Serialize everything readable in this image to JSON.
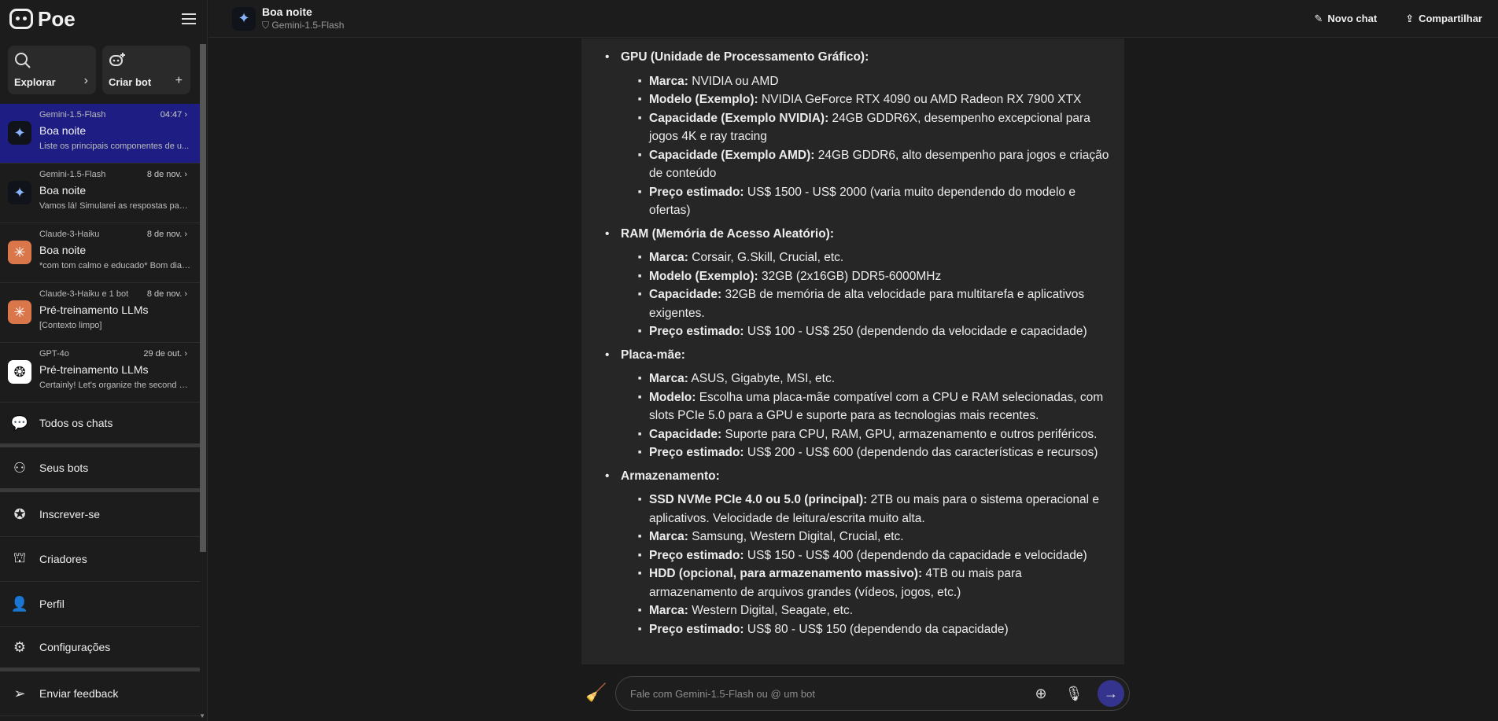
{
  "app": {
    "logo_text": "Poe"
  },
  "sidebar": {
    "cards": [
      {
        "label": "Explorar",
        "icon": "search-icon",
        "side": "›"
      },
      {
        "label": "Criar bot",
        "icon": "bot-add-icon",
        "side": "+"
      }
    ],
    "chats": [
      {
        "bot": "Gemini-1.5-Flash",
        "time": "04:47",
        "title": "Boa noite",
        "preview": "Liste os principais componentes de u...",
        "avatar": "gemini-icon",
        "active": true
      },
      {
        "bot": "Gemini-1.5-Flash",
        "time": "8 de nov.",
        "title": "Boa noite",
        "preview": "Vamos lá! Simularei as respostas para ...",
        "avatar": "gemini-icon",
        "active": false
      },
      {
        "bot": "Claude-3-Haiku",
        "time": "8 de nov.",
        "title": "Boa noite",
        "preview": "*com tom calmo e educado* Bom dia,...",
        "avatar": "claude-icon",
        "active": false
      },
      {
        "bot": "Claude-3-Haiku e 1 bot",
        "time": "8 de nov.",
        "title": "Pré-treinamento LLMs",
        "preview": "[Contexto limpo]",
        "avatar": "claude-icon",
        "active": false
      },
      {
        "bot": "GPT-4o",
        "time": "29 de out.",
        "title": "Pré-treinamento LLMs",
        "preview": "Certainly! Let's organize the second p...",
        "avatar": "openai-icon",
        "active": false
      }
    ],
    "nav": [
      {
        "label": "Todos os chats",
        "icon": "chats-icon"
      },
      {
        "label": "Seus bots",
        "icon": "bots-icon"
      },
      {
        "label": "Inscrever-se",
        "icon": "subscribe-icon"
      },
      {
        "label": "Criadores",
        "icon": "creators-icon"
      },
      {
        "label": "Perfil",
        "icon": "profile-icon"
      },
      {
        "label": "Configurações",
        "icon": "settings-icon"
      },
      {
        "label": "Enviar feedback",
        "icon": "feedback-icon"
      }
    ]
  },
  "header": {
    "title": "Boa noite",
    "subtitle": "Gemini-1.5-Flash",
    "new_chat": "Novo chat",
    "share": "Compartilhar"
  },
  "message": {
    "sections": [
      {
        "title": "GPU (Unidade de Processamento Gráfico):",
        "items": [
          {
            "label": "Marca:",
            "text": " NVIDIA ou AMD"
          },
          {
            "label": "Modelo (Exemplo):",
            "text": " NVIDIA GeForce RTX 4090 ou AMD Radeon RX 7900 XTX"
          },
          {
            "label": "Capacidade (Exemplo NVIDIA):",
            "text": " 24GB GDDR6X, desempenho excepcional para jogos 4K e ray tracing"
          },
          {
            "label": "Capacidade (Exemplo AMD):",
            "text": " 24GB GDDR6, alto desempenho para jogos e criação de conteúdo"
          },
          {
            "label": "Preço estimado:",
            "text": " US$ 1500 - US$ 2000 (varia muito dependendo do modelo e ofertas)"
          }
        ]
      },
      {
        "title": "RAM (Memória de Acesso Aleatório):",
        "items": [
          {
            "label": "Marca:",
            "text": " Corsair, G.Skill, Crucial, etc."
          },
          {
            "label": "Modelo (Exemplo):",
            "text": " 32GB (2x16GB) DDR5-6000MHz"
          },
          {
            "label": "Capacidade:",
            "text": " 32GB de memória de alta velocidade para multitarefa e aplicativos exigentes."
          },
          {
            "label": "Preço estimado:",
            "text": " US$ 100 - US$ 250 (dependendo da velocidade e capacidade)"
          }
        ]
      },
      {
        "title": "Placa-mãe:",
        "items": [
          {
            "label": "Marca:",
            "text": " ASUS, Gigabyte, MSI, etc."
          },
          {
            "label": "Modelo:",
            "text": " Escolha uma placa-mãe compatível com a CPU e RAM selecionadas, com slots PCIe 5.0 para a GPU e suporte para as tecnologias mais recentes."
          },
          {
            "label": "Capacidade:",
            "text": " Suporte para CPU, RAM, GPU, armazenamento e outros periféricos."
          },
          {
            "label": "Preço estimado:",
            "text": " US$ 200 - US$ 600 (dependendo das características e recursos)"
          }
        ]
      },
      {
        "title": "Armazenamento:",
        "items": [
          {
            "label": "SSD NVMe PCIe 4.0 ou 5.0 (principal):",
            "text": " 2TB ou mais para o sistema operacional e aplicativos. Velocidade de leitura/escrita muito alta."
          },
          {
            "label": "Marca:",
            "text": " Samsung, Western Digital, Crucial, etc."
          },
          {
            "label": "Preço estimado:",
            "text": " US$ 150 - US$ 400 (dependendo da capacidade e velocidade)"
          },
          {
            "label": "HDD (opcional, para armazenamento massivo):",
            "text": " 4TB ou mais para armazenamento de arquivos grandes (vídeos, jogos, etc.)"
          },
          {
            "label": "Marca:",
            "text": " Western Digital, Seagate, etc."
          },
          {
            "label": "Preço estimado:",
            "text": " US$ 80 - US$ 150 (dependendo da capacidade)"
          }
        ]
      }
    ]
  },
  "composer": {
    "placeholder": "Fale com Gemini-1.5-Flash ou @ um bot"
  },
  "colors": {
    "active_chat": "#1d1d83",
    "send_button": "#34348f",
    "background": "#1a1a1a",
    "message_bg": "#262626"
  }
}
